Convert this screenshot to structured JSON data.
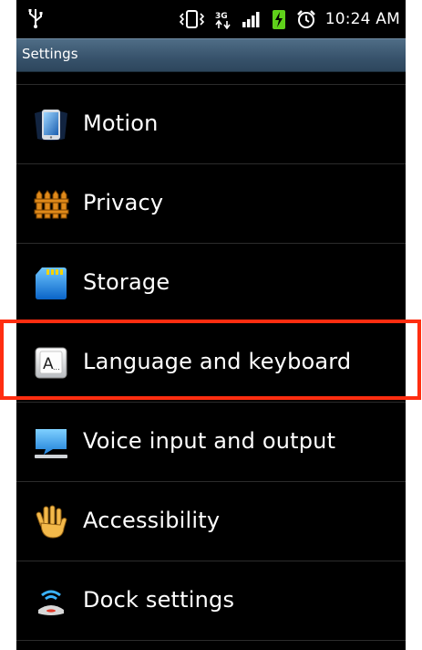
{
  "status_bar": {
    "time": "10:24 AM",
    "icons": [
      "usb-icon",
      "vibrate-icon",
      "3g-icon",
      "signal-icon",
      "battery-charging-icon",
      "alarm-icon"
    ]
  },
  "title_bar": {
    "title": "Settings"
  },
  "settings_items": [
    {
      "label": "Motion",
      "icon": "motion-phone-icon"
    },
    {
      "label": "Privacy",
      "icon": "privacy-fence-icon"
    },
    {
      "label": "Storage",
      "icon": "storage-sdcard-icon"
    },
    {
      "label": "Language and keyboard",
      "icon": "language-keyboard-icon"
    },
    {
      "label": "Voice input and output",
      "icon": "voice-monitor-icon"
    },
    {
      "label": "Accessibility",
      "icon": "accessibility-hand-icon"
    },
    {
      "label": "Dock settings",
      "icon": "dock-icon"
    }
  ],
  "annotation": {
    "highlighted_item": "Language and keyboard",
    "color": "#ff2d10"
  }
}
